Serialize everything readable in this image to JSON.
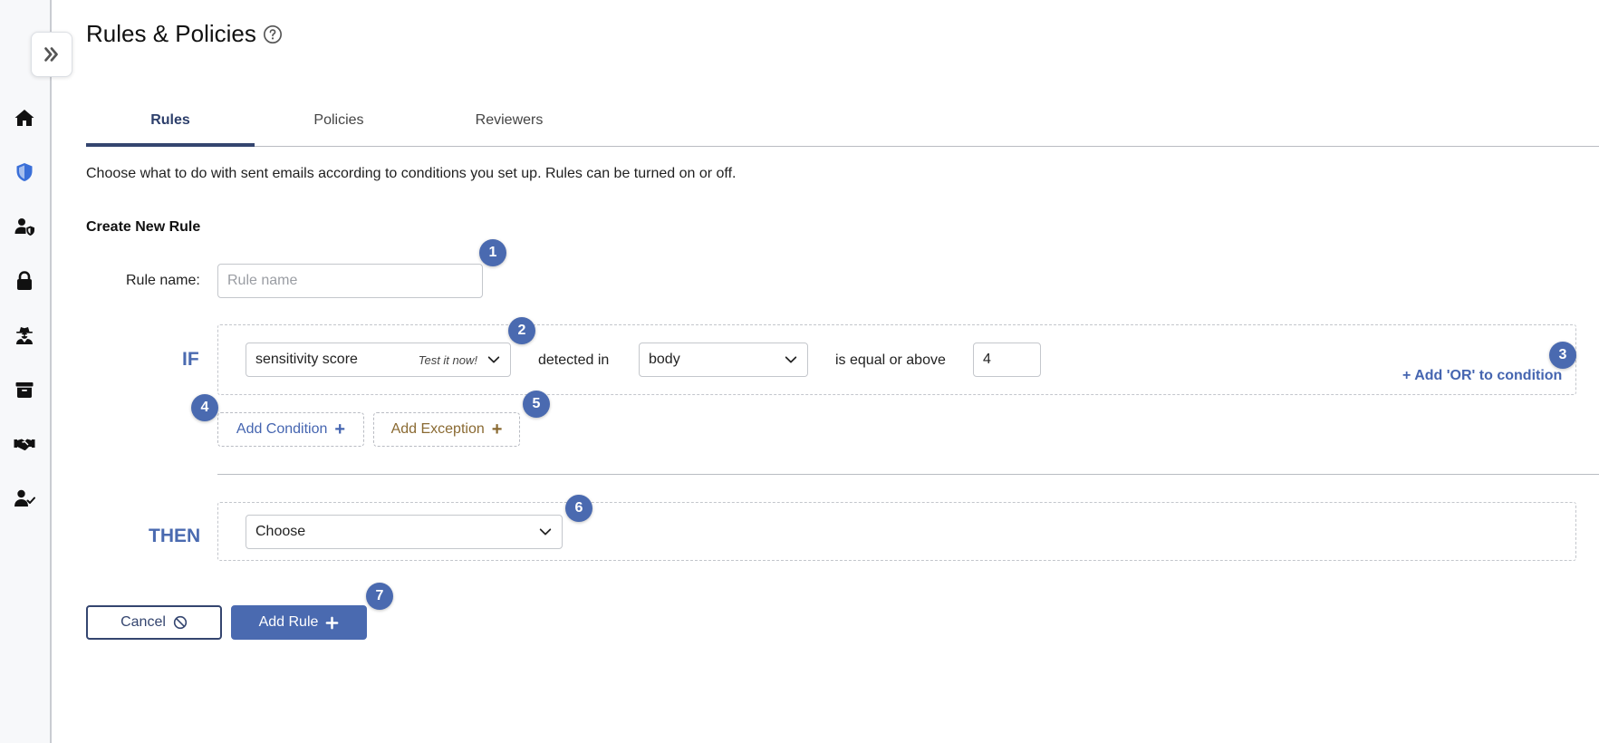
{
  "header": {
    "title": "Rules & Policies"
  },
  "tabs": [
    {
      "label": "Rules",
      "active": true
    },
    {
      "label": "Policies",
      "active": false
    },
    {
      "label": "Reviewers",
      "active": false
    }
  ],
  "description": "Choose what to do with sent emails according to conditions you set up. Rules can be turned on or off.",
  "form": {
    "section_title": "Create New Rule",
    "rule_name_label": "Rule name:",
    "rule_name_placeholder": "Rule name",
    "rule_name_value": "",
    "if_keyword": "IF",
    "condition": {
      "field_value": "sensitivity score",
      "test_link": "Test it now!",
      "detected_in_label": "detected in",
      "location_value": "body",
      "operator_label": "is equal or above",
      "threshold_value": "4"
    },
    "add_or_label": "+ Add 'OR' to condition",
    "add_condition_label": "Add Condition",
    "add_exception_label": "Add Exception",
    "then_keyword": "THEN",
    "action_value": "Choose",
    "cancel_label": "Cancel",
    "add_rule_label": "Add Rule"
  },
  "badges": [
    "1",
    "2",
    "3",
    "4",
    "5",
    "6",
    "7"
  ],
  "sidebar": {
    "items": [
      {
        "icon": "home-icon"
      },
      {
        "icon": "shield-icon"
      },
      {
        "icon": "user-shield-icon"
      },
      {
        "icon": "lock-icon"
      },
      {
        "icon": "user-secret-icon"
      },
      {
        "icon": "archive-icon"
      },
      {
        "icon": "handshake-icon"
      },
      {
        "icon": "user-check-icon"
      }
    ]
  },
  "colors": {
    "accent": "#4a6ab0",
    "navy": "#34456f",
    "exception": "#8a6a32",
    "shield_active": "#3a6fd8"
  }
}
